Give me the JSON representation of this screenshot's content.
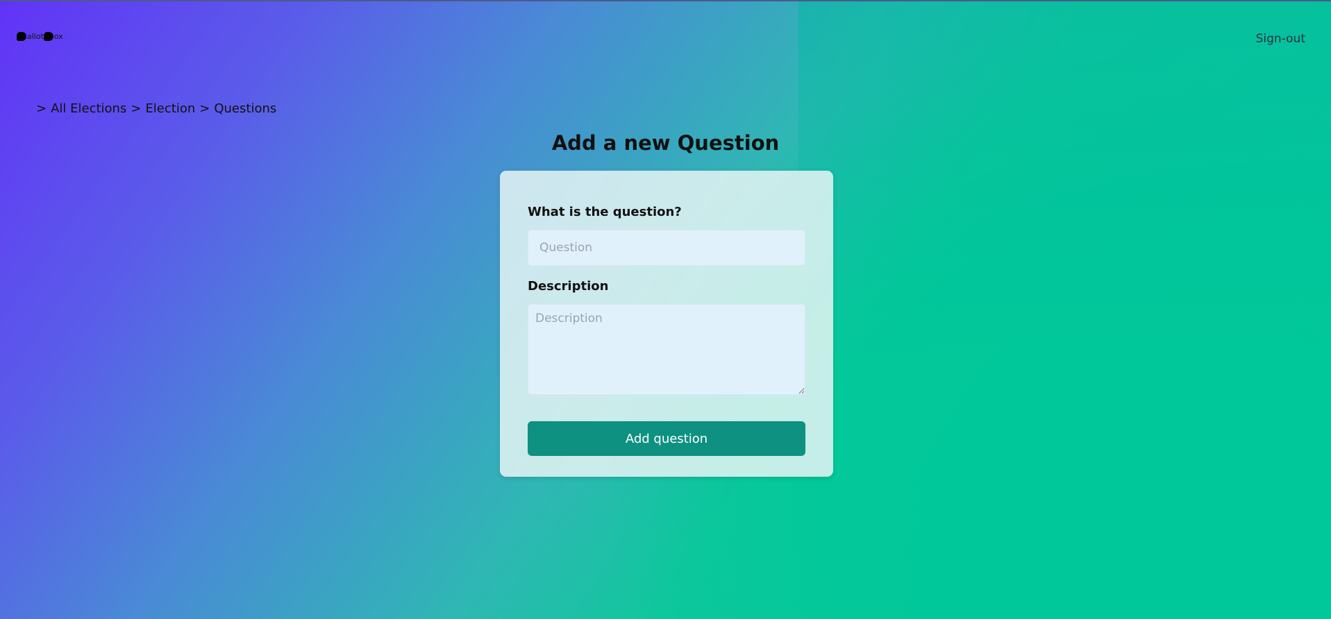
{
  "header": {
    "logo_text_1": "allot",
    "logo_text_2": "ox",
    "signout_label": "Sign-out"
  },
  "breadcrumb": {
    "prefix": ">",
    "items": [
      "All Elections",
      "Election",
      "Questions"
    ],
    "separator": ">"
  },
  "page": {
    "title": "Add a new Question"
  },
  "form": {
    "question_label": "What is the question?",
    "question_placeholder": "Question",
    "question_value": "",
    "description_label": "Description",
    "description_placeholder": "Description",
    "description_value": "",
    "submit_label": "Add question"
  },
  "colors": {
    "gradient_start": "#6233f7",
    "gradient_end": "#00c99a",
    "button": "#0e9181",
    "input_bg": "#e1f1fb"
  }
}
